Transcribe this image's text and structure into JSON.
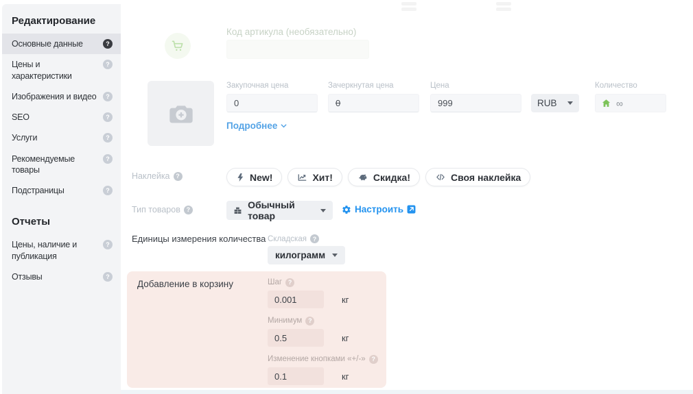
{
  "ui": {
    "question_mark": "?"
  },
  "colors": {
    "accent_blue": "#2493ef",
    "link_blue": "#54a3e6",
    "green": "#7dc35a",
    "pink_section_bg": "#f9ebe7",
    "sidebar_bg": "#f3f4f6",
    "active_item_bg": "#e3e4e9"
  },
  "sidebar": {
    "edit_header": "Редактирование",
    "reports_header": "Отчеты",
    "edit_items": [
      {
        "label": "Основные данные",
        "active": true
      },
      {
        "label": "Цены и характеристики",
        "active": false
      },
      {
        "label": "Изображения и видео",
        "active": false
      },
      {
        "label": "SEO",
        "active": false
      },
      {
        "label": "Услуги",
        "active": false
      },
      {
        "label": "Рекомендуемые товары",
        "active": false
      },
      {
        "label": "Подстраницы",
        "active": false
      }
    ],
    "report_items": [
      {
        "label": "Цены, наличие и публикация"
      },
      {
        "label": "Отзывы"
      }
    ]
  },
  "top": {
    "sku_label": "Код артикула (необязательно)",
    "sku_value": ""
  },
  "pricing": {
    "purchase_price_label": "Закупочная цена",
    "purchase_price_value": "0",
    "old_price_label": "Зачеркнутая цена",
    "old_price_value": "0",
    "price_label": "Цена",
    "price_value": "999",
    "currency_value": "RUB",
    "quantity_label": "Количество",
    "quantity_value": "∞",
    "more_link": "Подробнее"
  },
  "sticker": {
    "label": "Наклейка",
    "pills": [
      {
        "label": "New!",
        "icon": "lightning-icon"
      },
      {
        "label": "Хит!",
        "icon": "trend-chart-icon"
      },
      {
        "label": "Скидка!",
        "icon": "piggy-bank-icon"
      },
      {
        "label": "Своя наклейка",
        "icon": "code-icon"
      }
    ]
  },
  "product_type": {
    "label": "Тип товаров",
    "selected": "Обычный товар",
    "configure_link": "Настроить"
  },
  "units": {
    "label": "Единицы измерения количества",
    "stock_label": "Складская",
    "selected": "килограмм"
  },
  "cart_settings": {
    "title": "Добавление в корзину",
    "unit": "кг",
    "fields": [
      {
        "label": "Шаг",
        "value": "0.001"
      },
      {
        "label": "Минимум",
        "value": "0.5"
      },
      {
        "label": "Изменение кнопками «+/-»",
        "value": "0.1"
      }
    ]
  }
}
